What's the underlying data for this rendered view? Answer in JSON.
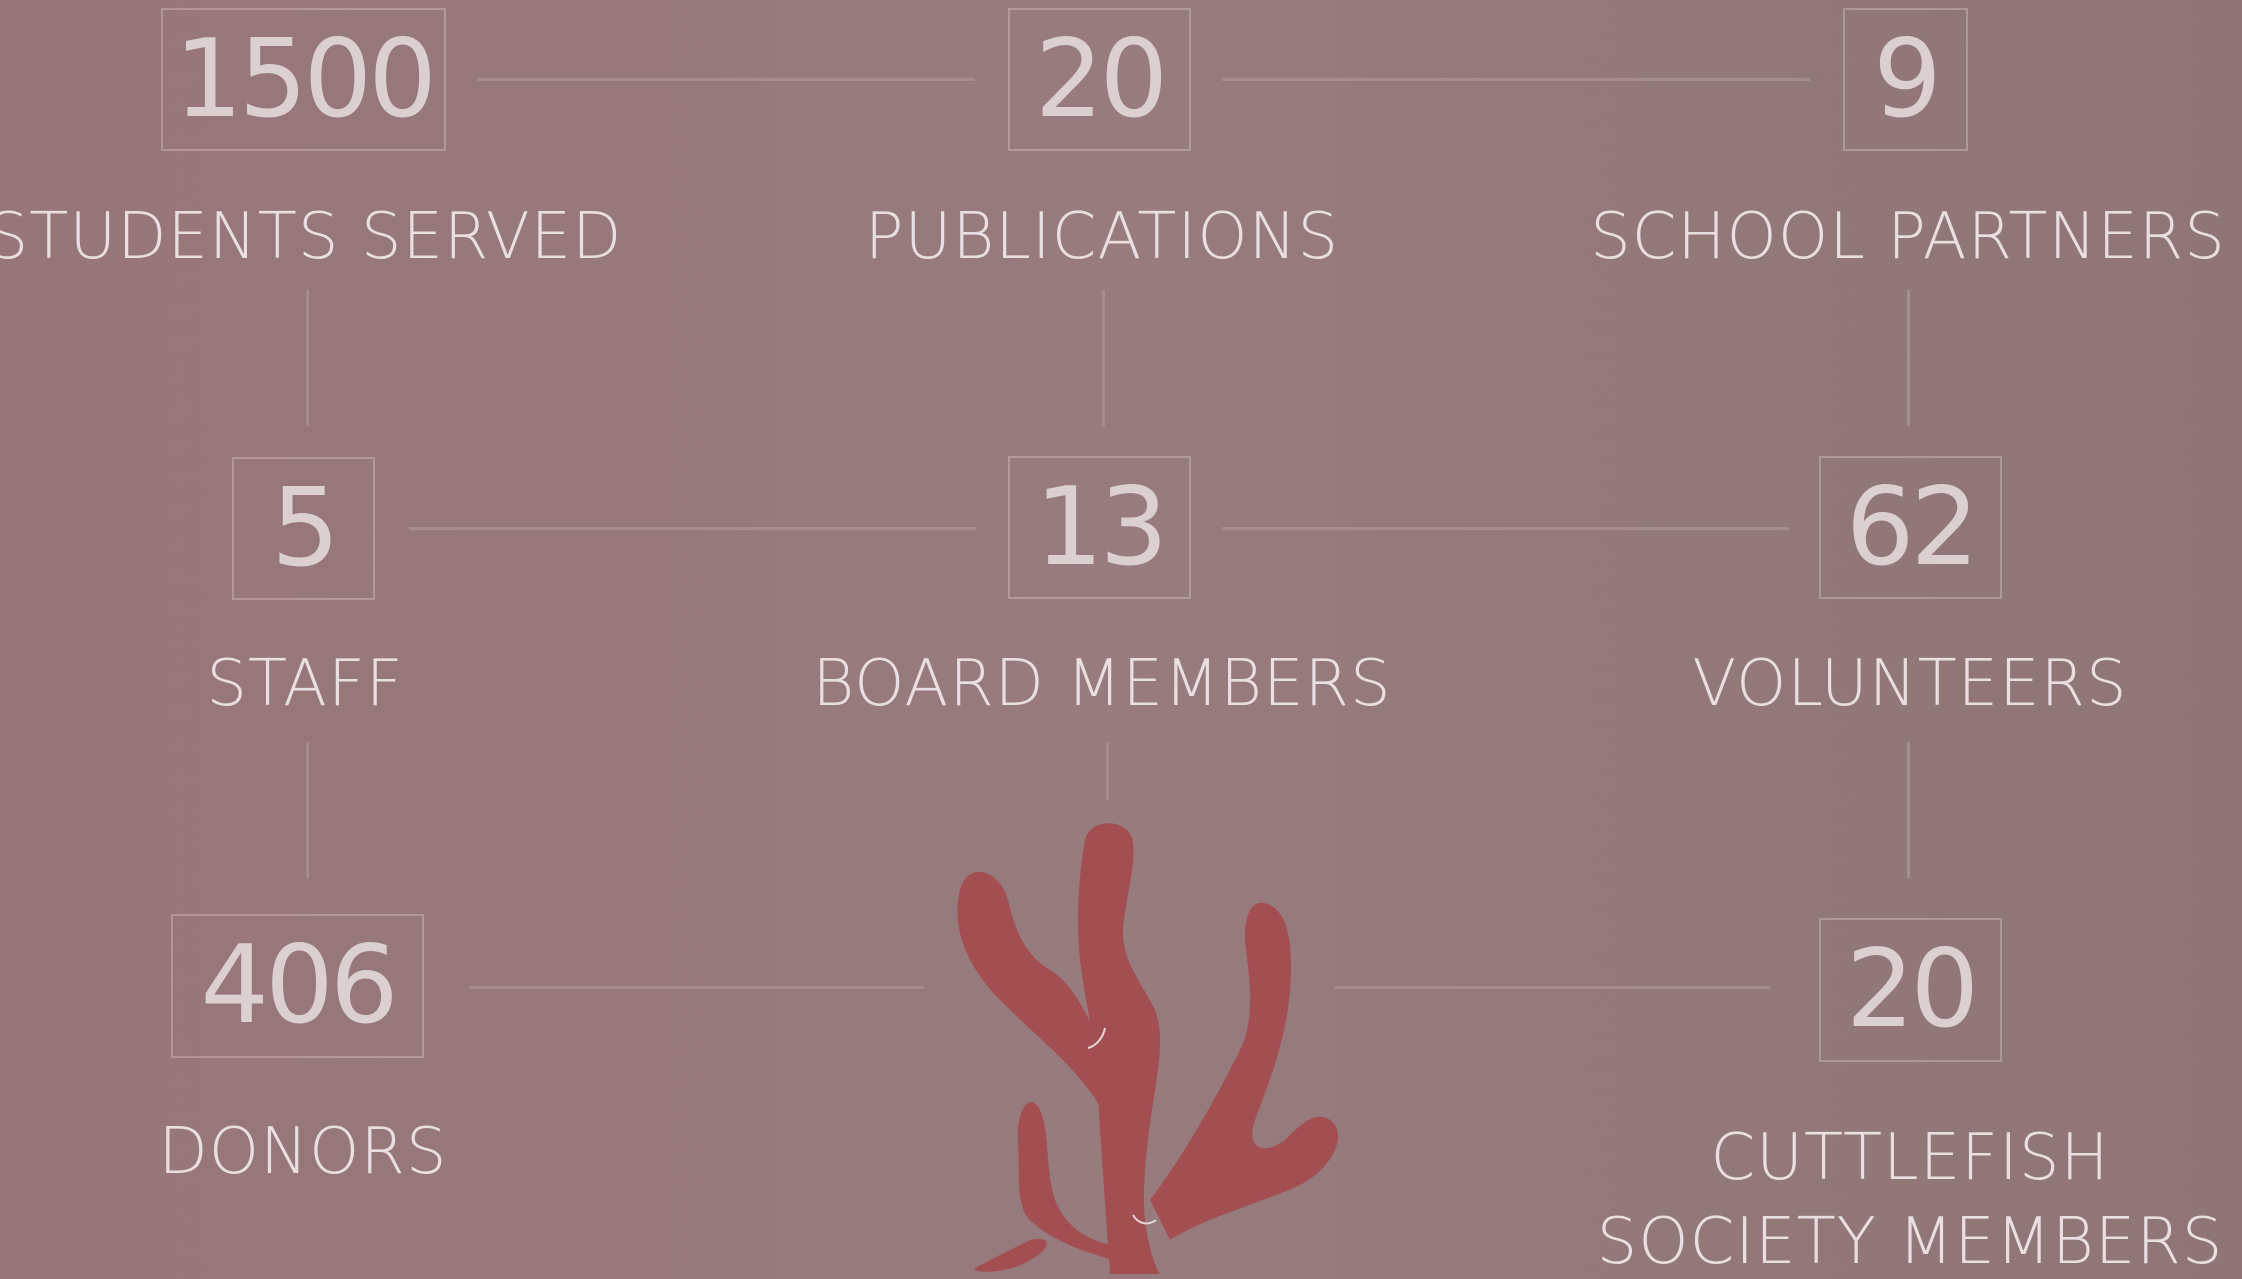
{
  "stats": [
    {
      "value": "1500",
      "label": "Students Served"
    },
    {
      "value": "20",
      "label": "Publications"
    },
    {
      "value": "9",
      "label": "School Partners"
    },
    {
      "value": "5",
      "label": "Staff"
    },
    {
      "value": "13",
      "label": "Board Members"
    },
    {
      "value": "62",
      "label": "Volunteers"
    },
    {
      "value": "406",
      "label": "Donors"
    },
    {
      "value": "20",
      "label": "Cuttlefish",
      "label2": "Society Members"
    }
  ],
  "colors": {
    "background": "#977679",
    "text": "#dccfd0",
    "coral": "#a34f52",
    "connector": "#aa9193"
  },
  "icon": "coral-illustration"
}
